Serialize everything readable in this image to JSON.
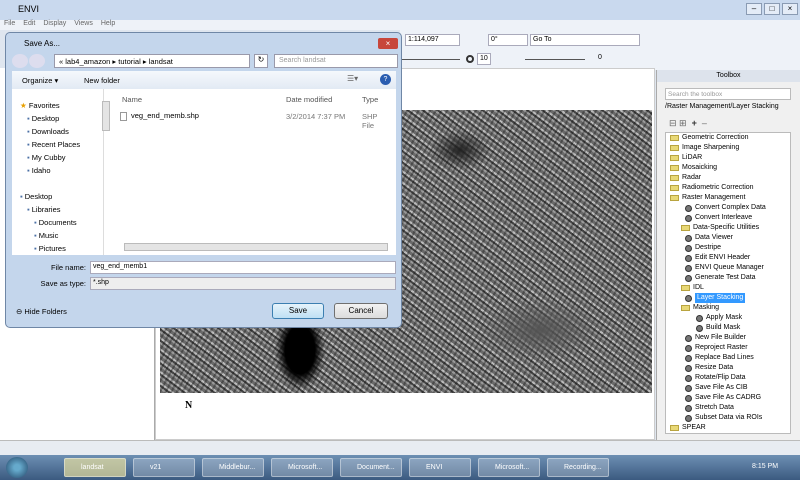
{
  "app": {
    "title": "ENVI",
    "menu": [
      "File",
      "Edit",
      "Display",
      "Views",
      "Help"
    ]
  },
  "toolbar": {
    "scale": "1:114,097",
    "rotation": "0°",
    "goto": "Go To",
    "transparency": "10",
    "sharpen": "0"
  },
  "toolbox": {
    "title": "Toolbox",
    "search_placeholder": "Search the toolbox",
    "path": "/Raster Management/Layer Stacking",
    "items": [
      {
        "label": "Geometric Correction",
        "type": "folder",
        "level": 0
      },
      {
        "label": "Image Sharpening",
        "type": "folder",
        "level": 0
      },
      {
        "label": "LiDAR",
        "type": "folder",
        "level": 0
      },
      {
        "label": "Mosaicking",
        "type": "folder",
        "level": 0
      },
      {
        "label": "Radar",
        "type": "folder",
        "level": 0
      },
      {
        "label": "Radiometric Correction",
        "type": "folder",
        "level": 0
      },
      {
        "label": "Raster Management",
        "type": "folder",
        "level": 0
      },
      {
        "label": "Convert Complex Data",
        "type": "tool",
        "level": 1
      },
      {
        "label": "Convert Interleave",
        "type": "tool",
        "level": 1
      },
      {
        "label": "Data-Specific Utilities",
        "type": "folder",
        "level": 1
      },
      {
        "label": "Data Viewer",
        "type": "tool",
        "level": 1
      },
      {
        "label": "Destripe",
        "type": "tool",
        "level": 1
      },
      {
        "label": "Edit ENVI Header",
        "type": "tool",
        "level": 1
      },
      {
        "label": "ENVI Queue Manager",
        "type": "tool",
        "level": 1
      },
      {
        "label": "Generate Test Data",
        "type": "tool",
        "level": 1
      },
      {
        "label": "IDL",
        "type": "folder",
        "level": 1
      },
      {
        "label": "Layer Stacking",
        "type": "tool",
        "level": 1,
        "selected": true
      },
      {
        "label": "Masking",
        "type": "folder",
        "level": 1
      },
      {
        "label": "Apply Mask",
        "type": "tool",
        "level": 2
      },
      {
        "label": "Build Mask",
        "type": "tool",
        "level": 2
      },
      {
        "label": "New File Builder",
        "type": "tool",
        "level": 1
      },
      {
        "label": "Reproject Raster",
        "type": "tool",
        "level": 1
      },
      {
        "label": "Replace Bad Lines",
        "type": "tool",
        "level": 1
      },
      {
        "label": "Resize Data",
        "type": "tool",
        "level": 1
      },
      {
        "label": "Rotate/Flip Data",
        "type": "tool",
        "level": 1
      },
      {
        "label": "Save File As CIB",
        "type": "tool",
        "level": 1
      },
      {
        "label": "Save File As CADRG",
        "type": "tool",
        "level": 1
      },
      {
        "label": "Stretch Data",
        "type": "tool",
        "level": 1
      },
      {
        "label": "Subset Data via ROIs",
        "type": "tool",
        "level": 1
      },
      {
        "label": "SPEAR",
        "type": "folder",
        "level": 0
      }
    ]
  },
  "map": {
    "north_label": "N"
  },
  "dialog": {
    "title": "Save As...",
    "breadcrumb": [
      "«",
      "lab4_amazon",
      "tutorial",
      "landsat"
    ],
    "search_placeholder": "Search landsat",
    "organize": "Organize ▾",
    "new_folder": "New folder",
    "nav": {
      "favorites": "Favorites",
      "fav_items": [
        "Desktop",
        "Downloads",
        "Recent Places",
        "My Cubby",
        "Idaho"
      ],
      "desktop": "Desktop",
      "libraries": "Libraries",
      "lib_items": [
        "Documents",
        "Music",
        "Pictures"
      ]
    },
    "columns": [
      "Name",
      "Date modified",
      "Type"
    ],
    "files": [
      {
        "name": "veg_end_memb.shp",
        "date": "3/2/2014 7:37 PM",
        "type": "SHP File"
      }
    ],
    "file_name_label": "File name:",
    "file_name": "veg_end_memb1",
    "save_type_label": "Save as type:",
    "save_type": "*.shp",
    "hide_folders": "Hide Folders",
    "save": "Save",
    "cancel": "Cancel"
  },
  "taskbar": {
    "items": [
      "landsat",
      "v21",
      "Middlebur...",
      "Microsoft...",
      "Document...",
      "ENVI",
      "Microsoft...",
      "Recording..."
    ],
    "clock": "8:15 PM"
  }
}
